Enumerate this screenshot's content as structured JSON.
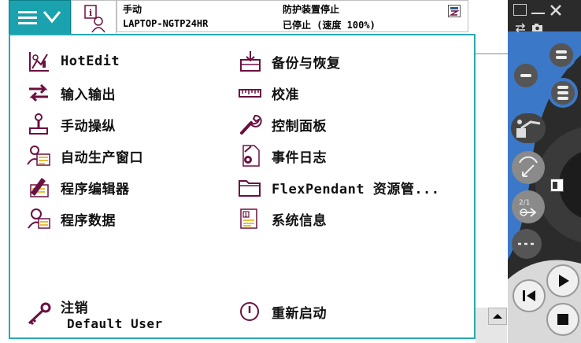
{
  "status": {
    "mode": "手动",
    "controller": "LAPTOP-NGTP24HR",
    "state_title": "防护装置停止",
    "state_detail": "已停止 (速度 100%)"
  },
  "menu": {
    "left": [
      {
        "label": "HotEdit",
        "icon": "hotedit-icon"
      },
      {
        "label": "输入输出",
        "icon": "io-icon"
      },
      {
        "label": "手动操纵",
        "icon": "joystick-icon"
      },
      {
        "label": "自动生产窗口",
        "icon": "auto-production-icon"
      },
      {
        "label": "程序编辑器",
        "icon": "program-editor-icon"
      },
      {
        "label": "程序数据",
        "icon": "program-data-icon"
      }
    ],
    "right": [
      {
        "label": "备份与恢复",
        "icon": "backup-restore-icon"
      },
      {
        "label": "校准",
        "icon": "calibration-icon"
      },
      {
        "label": "控制面板",
        "icon": "wrench-icon"
      },
      {
        "label": "事件日志",
        "icon": "event-log-icon"
      },
      {
        "label": "FlexPendant 资源管...",
        "icon": "folder-icon"
      },
      {
        "label": "系统信息",
        "icon": "system-info-icon"
      }
    ],
    "logoff_label": "注销",
    "logoff_user": "Default User",
    "restart_label": "重新启动"
  },
  "colors": {
    "accent": "#1aa2ae",
    "icon": "#6b1040",
    "jog_blue": "#3c78c8"
  }
}
